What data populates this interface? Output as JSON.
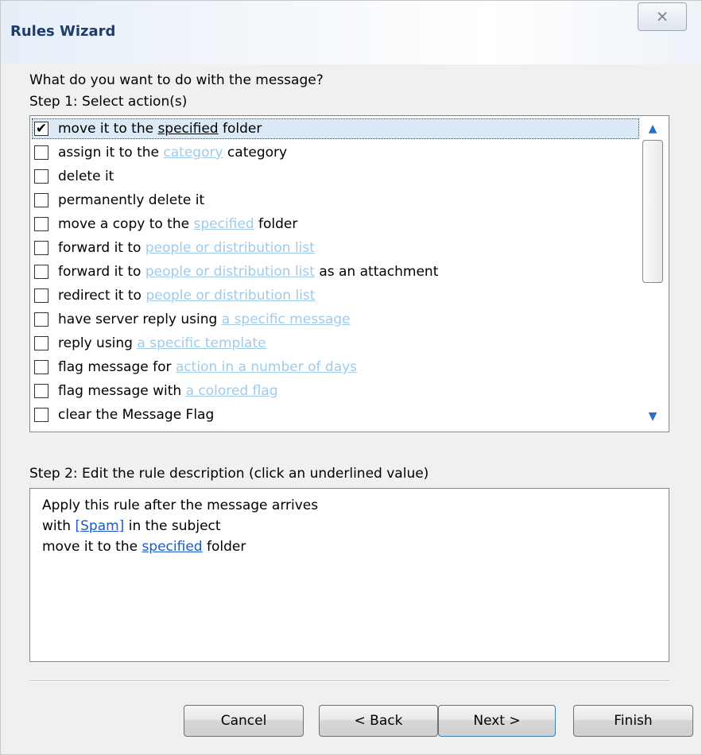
{
  "window": {
    "title": "Rules Wizard",
    "close_glyph": "⨯"
  },
  "question": "What do you want to do with the message?",
  "step1": {
    "label": "Step 1: Select action(s)",
    "actions": [
      {
        "checked": true,
        "parts": [
          {
            "t": "move it to the "
          },
          {
            "t": "specified",
            "link": true,
            "selected_link": true
          },
          {
            "t": " folder"
          }
        ]
      },
      {
        "checked": false,
        "parts": [
          {
            "t": "assign it to the "
          },
          {
            "t": "category",
            "link": true
          },
          {
            "t": " category"
          }
        ]
      },
      {
        "checked": false,
        "parts": [
          {
            "t": "delete it"
          }
        ]
      },
      {
        "checked": false,
        "parts": [
          {
            "t": "permanently delete it"
          }
        ]
      },
      {
        "checked": false,
        "parts": [
          {
            "t": "move a copy to the "
          },
          {
            "t": "specified",
            "link": true
          },
          {
            "t": " folder"
          }
        ]
      },
      {
        "checked": false,
        "parts": [
          {
            "t": "forward it to "
          },
          {
            "t": "people or distribution list",
            "link": true
          }
        ]
      },
      {
        "checked": false,
        "parts": [
          {
            "t": "forward it to "
          },
          {
            "t": "people or distribution list",
            "link": true
          },
          {
            "t": " as an attachment"
          }
        ]
      },
      {
        "checked": false,
        "parts": [
          {
            "t": "redirect it to "
          },
          {
            "t": "people or distribution list",
            "link": true
          }
        ]
      },
      {
        "checked": false,
        "parts": [
          {
            "t": "have server reply using "
          },
          {
            "t": "a specific message",
            "link": true
          }
        ]
      },
      {
        "checked": false,
        "parts": [
          {
            "t": "reply using "
          },
          {
            "t": "a specific template",
            "link": true
          }
        ]
      },
      {
        "checked": false,
        "parts": [
          {
            "t": "flag message for "
          },
          {
            "t": "action in a number of days",
            "link": true
          }
        ]
      },
      {
        "checked": false,
        "parts": [
          {
            "t": "flag message with "
          },
          {
            "t": "a colored flag",
            "link": true
          }
        ]
      },
      {
        "checked": false,
        "parts": [
          {
            "t": "clear the Message Flag"
          }
        ]
      }
    ]
  },
  "step2": {
    "label": "Step 2: Edit the rule description (click an underlined value)",
    "lines": [
      [
        {
          "t": "Apply this rule after the message arrives"
        }
      ],
      [
        {
          "t": "with "
        },
        {
          "t": "[Spam]",
          "link": true
        },
        {
          "t": " in the subject"
        }
      ],
      [
        {
          "t": "move it to the "
        },
        {
          "t": "specified",
          "link": true
        },
        {
          "t": " folder"
        }
      ]
    ]
  },
  "buttons": {
    "cancel": "Cancel",
    "back": "< Back",
    "next": "Next >",
    "finish": "Finish"
  },
  "colors": {
    "link": "#1a5bc8",
    "link_faded": "#9fcbeb",
    "title_text": "#1e3c6c",
    "selected_row": "#dce9f6"
  }
}
